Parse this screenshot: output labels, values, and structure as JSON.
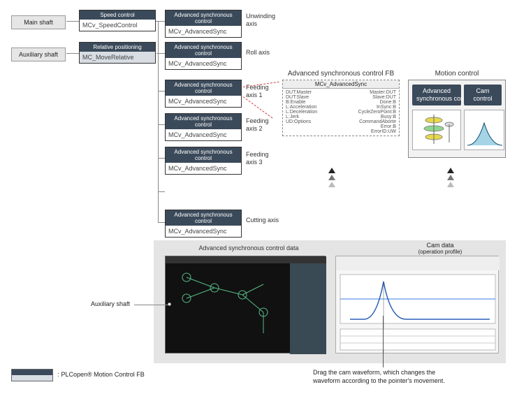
{
  "shafts": {
    "main": "Main shaft",
    "aux": "Auxiliary shaft",
    "aux2": "Auxiliary shaft"
  },
  "fb": {
    "speed_hdr": "Speed control",
    "speed_body": "MCv_SpeedControl",
    "rel_hdr": "Relative positioning",
    "rel_body": "MC_MoveRelative",
    "adv_hdr": "Advanced synchronous control",
    "adv_body": "MCv_AdvancedSync"
  },
  "axes": {
    "unwind": "Unwinding\naxis",
    "roll": "Roll axis",
    "f1": "Feeding\naxis 1",
    "f2": "Feeding\naxis 2",
    "f3": "Feeding\naxis 3",
    "cut": "Cutting axis"
  },
  "detail": {
    "title": "Advanced synchronous control FB",
    "hdr": "MCv_AdvancedSync",
    "left": [
      "DUT:Master",
      "DUT:Slave",
      "B:Enable",
      "L:Acceleration",
      "L:Deceleration",
      "L:Jerk",
      "UD:Options"
    ],
    "right": [
      "Master:DUT",
      "Slave:DUT",
      "Done:B",
      "InSync:B",
      "CycleZeroPoint:B",
      "Busy:B",
      "CommandAborte",
      "Error:B",
      "ErrorID:UW"
    ]
  },
  "motion": {
    "title": "Motion control",
    "box1": "Advanced\nsynchronous control",
    "box2": "Cam control"
  },
  "panels": {
    "adv_data": "Advanced synchronous control data",
    "cam_title": "Cam data",
    "cam_sub": "(operation profile)"
  },
  "caption": "Drag the cam waveform, which changes the\nwaveform according to the pointer's movement.",
  "legend": ": PLCopen® Motion Control  FB"
}
